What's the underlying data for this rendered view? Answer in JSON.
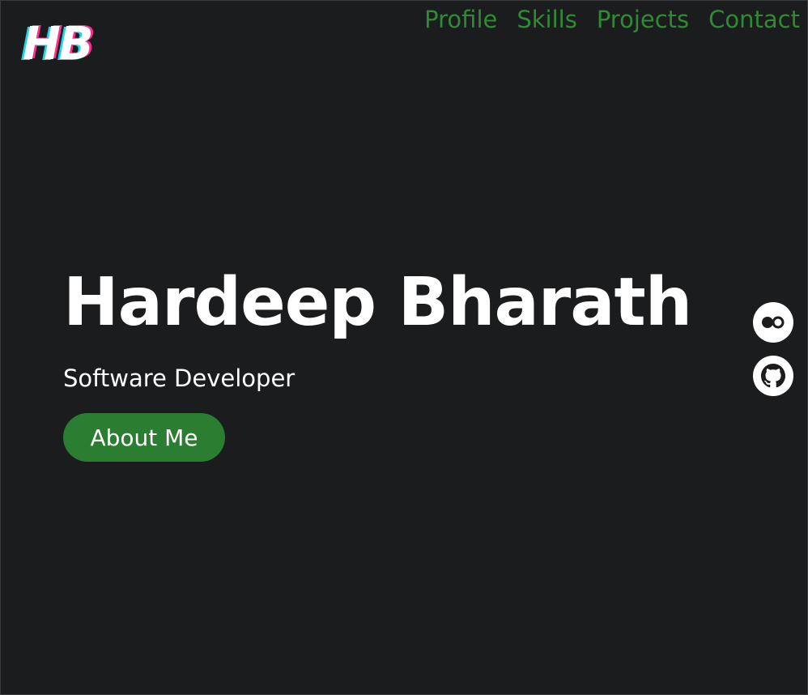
{
  "logo": {
    "text": "HB",
    "accent_cyan": "#22d3e6",
    "accent_pink": "#ff2d8f"
  },
  "nav": {
    "items": [
      {
        "label": "Profile"
      },
      {
        "label": "Skills"
      },
      {
        "label": "Projects"
      },
      {
        "label": "Contact"
      }
    ],
    "color": "#2f8a33"
  },
  "hero": {
    "name": "Hardeep Bharath",
    "role": "Software Developer",
    "button_label": "About Me",
    "button_color": "#2a7d31"
  },
  "social": [
    {
      "icon": "flickr-icon"
    },
    {
      "icon": "github-icon"
    }
  ],
  "theme": {
    "background": "#1b1c1e",
    "text": "#ffffff"
  }
}
